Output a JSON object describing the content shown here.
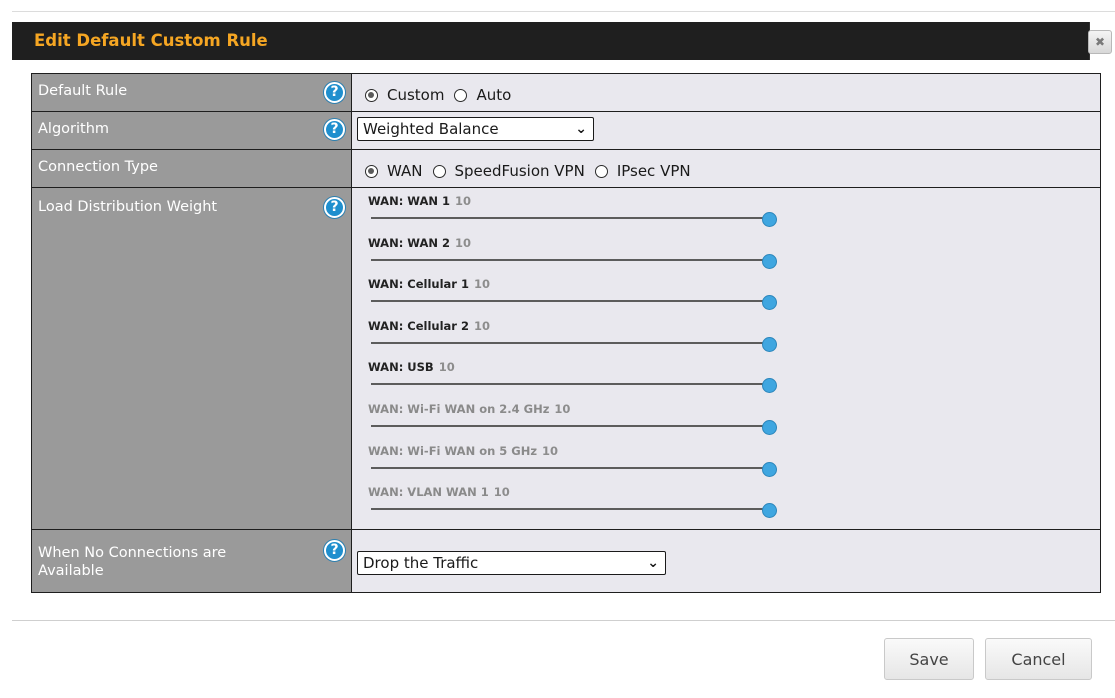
{
  "dialog": {
    "title": "Edit Default Custom Rule",
    "close_symbol": "✖"
  },
  "rows": {
    "default_rule": {
      "label": "Default Rule",
      "options": [
        "Custom",
        "Auto"
      ],
      "selected": "Custom"
    },
    "algorithm": {
      "label": "Algorithm",
      "value": "Weighted Balance"
    },
    "connection_type": {
      "label": "Connection Type",
      "options": [
        "WAN",
        "SpeedFusion VPN",
        "IPsec VPN"
      ],
      "selected": "WAN"
    },
    "load_distribution": {
      "label": "Load Distribution Weight",
      "weights": [
        {
          "name": "WAN: WAN 1",
          "value": "10",
          "level": 1.0,
          "enabled": true
        },
        {
          "name": "WAN: WAN 2",
          "value": "10",
          "level": 1.0,
          "enabled": true
        },
        {
          "name": "WAN: Cellular 1",
          "value": "10",
          "level": 1.0,
          "enabled": true
        },
        {
          "name": "WAN: Cellular 2",
          "value": "10",
          "level": 1.0,
          "enabled": true
        },
        {
          "name": "WAN: USB",
          "value": "10",
          "level": 1.0,
          "enabled": true
        },
        {
          "name": "WAN: Wi-Fi WAN on 2.4 GHz",
          "value": "10",
          "level": 1.0,
          "enabled": false
        },
        {
          "name": "WAN: Wi-Fi WAN on 5 GHz",
          "value": "10",
          "level": 1.0,
          "enabled": false
        },
        {
          "name": "WAN: VLAN WAN 1",
          "value": "10",
          "level": 1.0,
          "enabled": false
        }
      ]
    },
    "no_connections": {
      "label_line1": "When No Connections are",
      "label_line2": "Available",
      "value": "Drop the Traffic"
    }
  },
  "help_symbol": "?",
  "buttons": {
    "save": "Save",
    "cancel": "Cancel"
  },
  "colors": {
    "title": "#f5a623",
    "help": "#1f8fce",
    "slider_thumb": "#3fa6e0"
  }
}
